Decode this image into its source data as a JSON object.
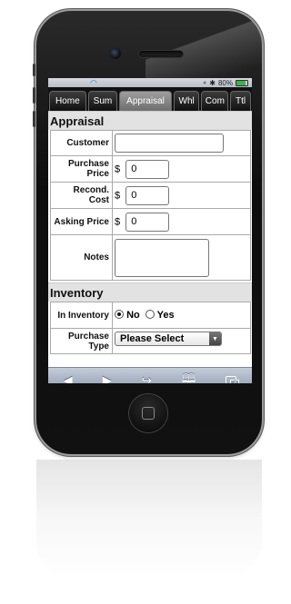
{
  "status_bar": {
    "battery": "80%"
  },
  "tabs": [
    {
      "label": "Home",
      "active": false
    },
    {
      "label": "Sum",
      "active": false
    },
    {
      "label": "Appraisal",
      "active": true
    },
    {
      "label": "Whl",
      "active": false
    },
    {
      "label": "Com",
      "active": false
    },
    {
      "label": "Ttl",
      "active": false
    }
  ],
  "appraisal": {
    "title": "Appraisal",
    "customer_label": "Customer",
    "customer_value": "",
    "purchase_price_label": "Purchase Price",
    "purchase_price_currency": "$",
    "purchase_price_value": "0",
    "recond_cost_label": "Recond. Cost",
    "recond_cost_currency": "$",
    "recond_cost_value": "0",
    "asking_price_label": "Asking Price",
    "asking_price_currency": "$",
    "asking_price_value": "0",
    "notes_label": "Notes",
    "notes_value": ""
  },
  "inventory": {
    "title": "Inventory",
    "in_inventory_label": "In Inventory",
    "option_no": "No",
    "option_yes": "Yes",
    "selected": "No",
    "purchase_type_label": "Purchase Type",
    "purchase_type_value": "Please Select"
  },
  "browser_toolbar": {
    "tab_count": "4",
    "icons": [
      "back-arrow-icon",
      "forward-arrow-icon",
      "share-icon",
      "bookmarks-icon",
      "tabs-icon"
    ]
  },
  "colors": {
    "active_tab": "#8a8a8a",
    "tab_bar": "#111111",
    "section_header": "#e2e2e2",
    "toolbar": "#a6b2c4",
    "wifi": "#1e6fcf",
    "battery": "#3bb34a"
  }
}
